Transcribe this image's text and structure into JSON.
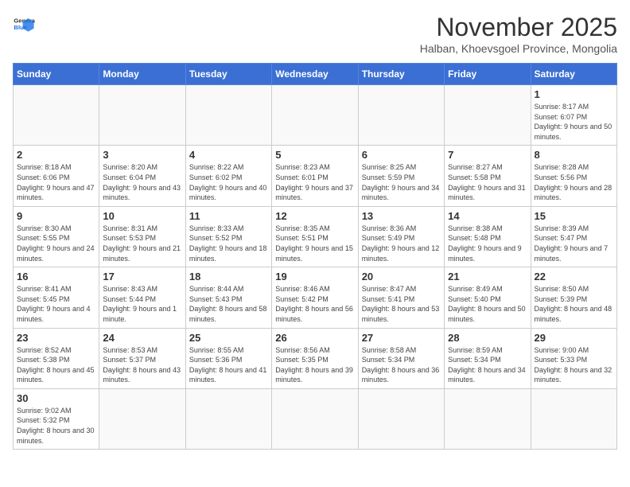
{
  "header": {
    "logo_general": "General",
    "logo_blue": "Blue",
    "month_title": "November 2025",
    "location": "Halban, Khoevsgoel Province, Mongolia"
  },
  "days_of_week": [
    "Sunday",
    "Monday",
    "Tuesday",
    "Wednesday",
    "Thursday",
    "Friday",
    "Saturday"
  ],
  "weeks": [
    [
      {
        "day": "",
        "content": ""
      },
      {
        "day": "",
        "content": ""
      },
      {
        "day": "",
        "content": ""
      },
      {
        "day": "",
        "content": ""
      },
      {
        "day": "",
        "content": ""
      },
      {
        "day": "",
        "content": ""
      },
      {
        "day": "1",
        "content": "Sunrise: 8:17 AM\nSunset: 6:07 PM\nDaylight: 9 hours and 50 minutes."
      }
    ],
    [
      {
        "day": "2",
        "content": "Sunrise: 8:18 AM\nSunset: 6:06 PM\nDaylight: 9 hours and 47 minutes."
      },
      {
        "day": "3",
        "content": "Sunrise: 8:20 AM\nSunset: 6:04 PM\nDaylight: 9 hours and 43 minutes."
      },
      {
        "day": "4",
        "content": "Sunrise: 8:22 AM\nSunset: 6:02 PM\nDaylight: 9 hours and 40 minutes."
      },
      {
        "day": "5",
        "content": "Sunrise: 8:23 AM\nSunset: 6:01 PM\nDaylight: 9 hours and 37 minutes."
      },
      {
        "day": "6",
        "content": "Sunrise: 8:25 AM\nSunset: 5:59 PM\nDaylight: 9 hours and 34 minutes."
      },
      {
        "day": "7",
        "content": "Sunrise: 8:27 AM\nSunset: 5:58 PM\nDaylight: 9 hours and 31 minutes."
      },
      {
        "day": "8",
        "content": "Sunrise: 8:28 AM\nSunset: 5:56 PM\nDaylight: 9 hours and 28 minutes."
      }
    ],
    [
      {
        "day": "9",
        "content": "Sunrise: 8:30 AM\nSunset: 5:55 PM\nDaylight: 9 hours and 24 minutes."
      },
      {
        "day": "10",
        "content": "Sunrise: 8:31 AM\nSunset: 5:53 PM\nDaylight: 9 hours and 21 minutes."
      },
      {
        "day": "11",
        "content": "Sunrise: 8:33 AM\nSunset: 5:52 PM\nDaylight: 9 hours and 18 minutes."
      },
      {
        "day": "12",
        "content": "Sunrise: 8:35 AM\nSunset: 5:51 PM\nDaylight: 9 hours and 15 minutes."
      },
      {
        "day": "13",
        "content": "Sunrise: 8:36 AM\nSunset: 5:49 PM\nDaylight: 9 hours and 12 minutes."
      },
      {
        "day": "14",
        "content": "Sunrise: 8:38 AM\nSunset: 5:48 PM\nDaylight: 9 hours and 9 minutes."
      },
      {
        "day": "15",
        "content": "Sunrise: 8:39 AM\nSunset: 5:47 PM\nDaylight: 9 hours and 7 minutes."
      }
    ],
    [
      {
        "day": "16",
        "content": "Sunrise: 8:41 AM\nSunset: 5:45 PM\nDaylight: 9 hours and 4 minutes."
      },
      {
        "day": "17",
        "content": "Sunrise: 8:43 AM\nSunset: 5:44 PM\nDaylight: 9 hours and 1 minute."
      },
      {
        "day": "18",
        "content": "Sunrise: 8:44 AM\nSunset: 5:43 PM\nDaylight: 8 hours and 58 minutes."
      },
      {
        "day": "19",
        "content": "Sunrise: 8:46 AM\nSunset: 5:42 PM\nDaylight: 8 hours and 56 minutes."
      },
      {
        "day": "20",
        "content": "Sunrise: 8:47 AM\nSunset: 5:41 PM\nDaylight: 8 hours and 53 minutes."
      },
      {
        "day": "21",
        "content": "Sunrise: 8:49 AM\nSunset: 5:40 PM\nDaylight: 8 hours and 50 minutes."
      },
      {
        "day": "22",
        "content": "Sunrise: 8:50 AM\nSunset: 5:39 PM\nDaylight: 8 hours and 48 minutes."
      }
    ],
    [
      {
        "day": "23",
        "content": "Sunrise: 8:52 AM\nSunset: 5:38 PM\nDaylight: 8 hours and 45 minutes."
      },
      {
        "day": "24",
        "content": "Sunrise: 8:53 AM\nSunset: 5:37 PM\nDaylight: 8 hours and 43 minutes."
      },
      {
        "day": "25",
        "content": "Sunrise: 8:55 AM\nSunset: 5:36 PM\nDaylight: 8 hours and 41 minutes."
      },
      {
        "day": "26",
        "content": "Sunrise: 8:56 AM\nSunset: 5:35 PM\nDaylight: 8 hours and 39 minutes."
      },
      {
        "day": "27",
        "content": "Sunrise: 8:58 AM\nSunset: 5:34 PM\nDaylight: 8 hours and 36 minutes."
      },
      {
        "day": "28",
        "content": "Sunrise: 8:59 AM\nSunset: 5:34 PM\nDaylight: 8 hours and 34 minutes."
      },
      {
        "day": "29",
        "content": "Sunrise: 9:00 AM\nSunset: 5:33 PM\nDaylight: 8 hours and 32 minutes."
      }
    ],
    [
      {
        "day": "30",
        "content": "Sunrise: 9:02 AM\nSunset: 5:32 PM\nDaylight: 8 hours and 30 minutes."
      },
      {
        "day": "",
        "content": ""
      },
      {
        "day": "",
        "content": ""
      },
      {
        "day": "",
        "content": ""
      },
      {
        "day": "",
        "content": ""
      },
      {
        "day": "",
        "content": ""
      },
      {
        "day": "",
        "content": ""
      }
    ]
  ]
}
